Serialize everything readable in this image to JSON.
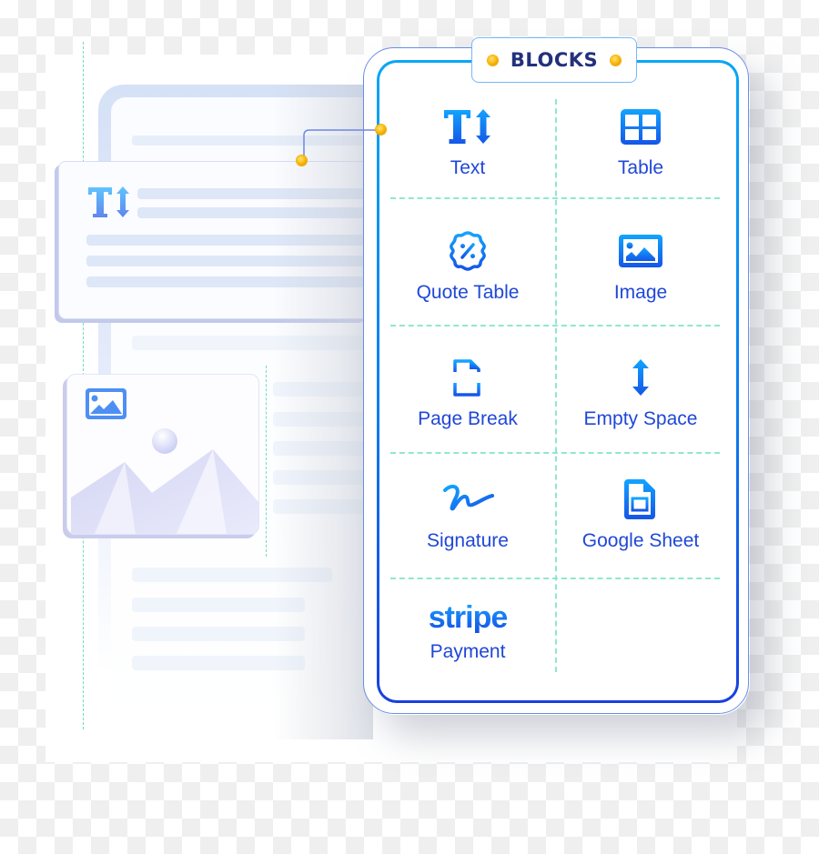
{
  "panel": {
    "title": "BLOCKS",
    "blocks": [
      {
        "label": "Text",
        "icon": "text-size-icon"
      },
      {
        "label": "Table",
        "icon": "table-icon"
      },
      {
        "label": "Quote Table",
        "icon": "percent-badge-icon"
      },
      {
        "label": "Image",
        "icon": "image-icon"
      },
      {
        "label": "Page Break",
        "icon": "page-break-icon"
      },
      {
        "label": "Empty Space",
        "icon": "vertical-arrows-icon"
      },
      {
        "label": "Signature",
        "icon": "signature-icon"
      },
      {
        "label": "Google Sheet",
        "icon": "spreadsheet-icon"
      },
      {
        "label": "Payment",
        "icon": "stripe-logo",
        "logo_text": "stripe"
      }
    ]
  },
  "colors": {
    "accent_blue": "#1f47d8",
    "title_navy": "#23307c",
    "divider_mint": "#8ee8cf",
    "connector_gold": "#ffc21a"
  }
}
